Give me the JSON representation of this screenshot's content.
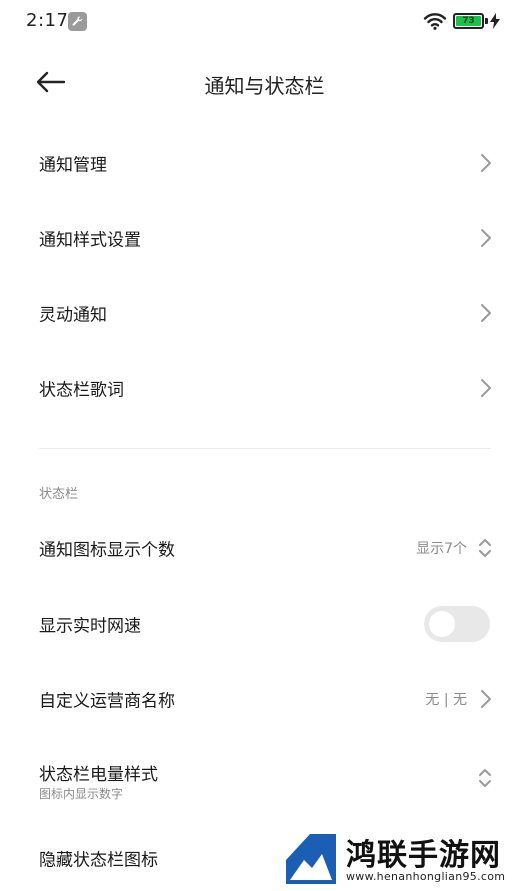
{
  "status_bar": {
    "time": "2:17",
    "battery_level": "73",
    "battery_color": "#1bc14a",
    "icons": [
      "wrench-icon",
      "wifi-icon",
      "battery-icon",
      "charging-bolt-icon"
    ]
  },
  "header": {
    "title": "通知与状态栏",
    "back_icon": "back-arrow-icon"
  },
  "menu": [
    {
      "label": "通知管理"
    },
    {
      "label": "通知样式设置"
    },
    {
      "label": "灵动通知"
    },
    {
      "label": "状态栏歌词"
    }
  ],
  "status_section": {
    "title": "状态栏",
    "icon_count": {
      "label": "通知图标显示个数",
      "value": "显示7个"
    },
    "net_speed": {
      "label": "显示实时网速",
      "enabled": false
    },
    "carrier_name": {
      "label": "自定义运营商名称",
      "value": "无 | 无"
    },
    "battery_style": {
      "label": "状态栏电量样式",
      "sub": "图标内显示数字"
    },
    "hide_icons": {
      "label": "隐藏状态栏图标"
    }
  },
  "watermark": {
    "title": "鸿联手游网",
    "url": "www.henanhonglian95.com"
  }
}
